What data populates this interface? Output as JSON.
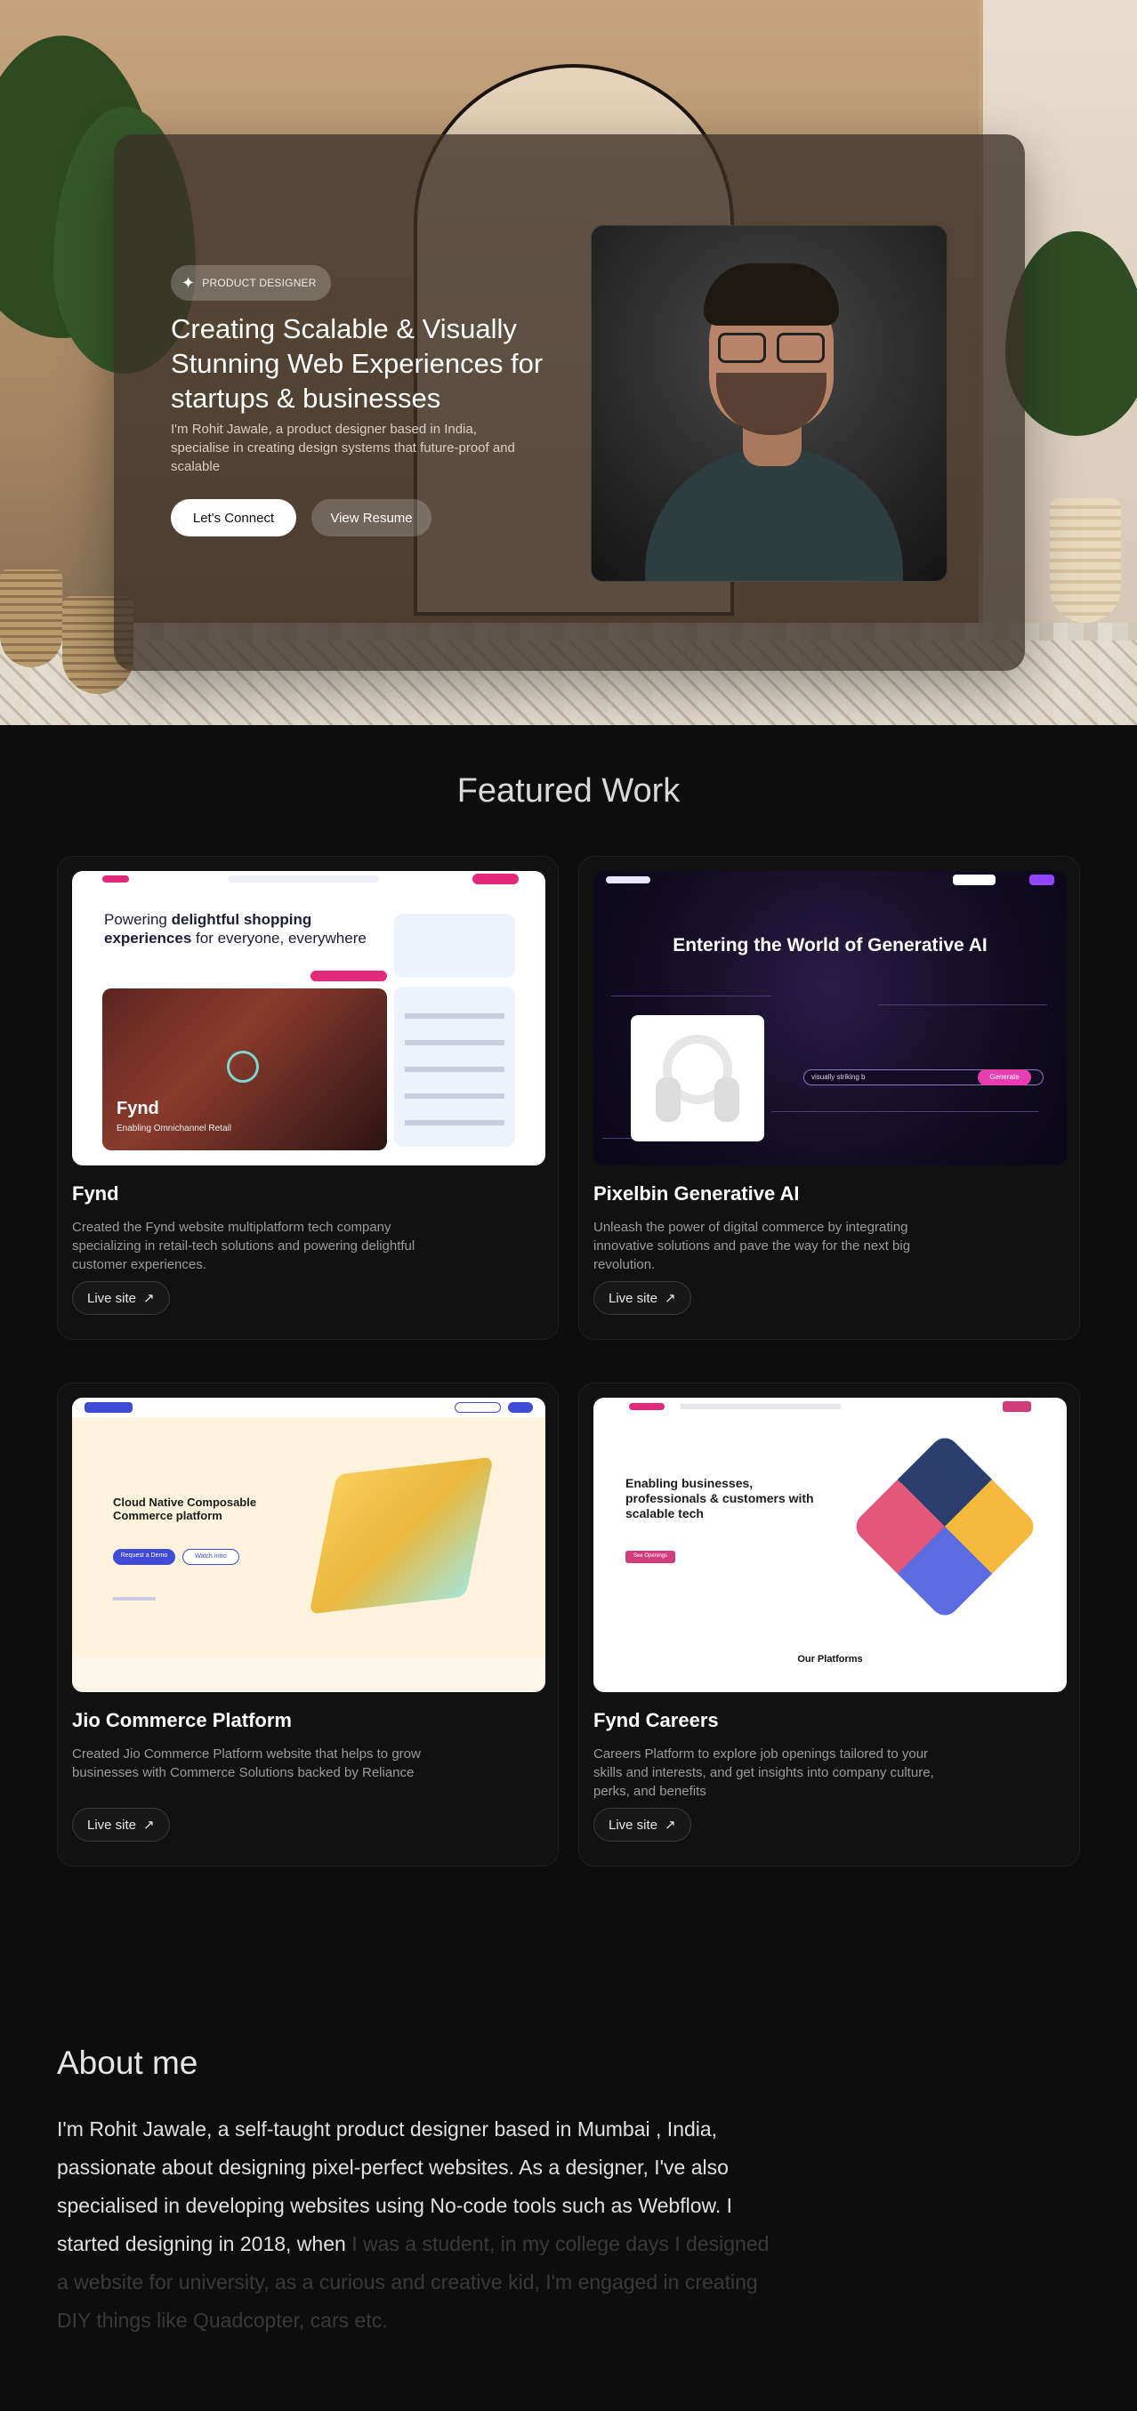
{
  "hero": {
    "badge": "PRODUCT DESIGNER",
    "title": "Creating Scalable & Visually Stunning Web Experiences for startups & businesses",
    "subtitle": "I'm Rohit Jawale, a product designer based in India, specialise in creating design systems that future-proof and scalable",
    "primary_button": "Let's Connect",
    "secondary_button": "View Resume"
  },
  "featured": {
    "title": "Featured Work",
    "live_label": "Live site",
    "projects": [
      {
        "title": "Fynd",
        "description": "Created the Fynd website multiplatform tech company specializing in retail-tech solutions and powering delightful customer experiences.",
        "preview": {
          "headline_a": "Powering ",
          "headline_b": "delightful shopping experiences",
          "headline_c": " for everyone, everywhere",
          "logo": "Fynd",
          "caption": "Enabling Omnichannel Retail"
        }
      },
      {
        "title": "Pixelbin Generative AI",
        "description": "Unleash the power of digital commerce by integrating innovative solutions and pave the way for the next big revolution.",
        "preview": {
          "headline": "Entering the World of Generative AI",
          "prompt": "visually striking b",
          "button": "Generate"
        }
      },
      {
        "title": "Jio Commerce Platform",
        "description": "Created Jio Commerce Platform website that helps to grow businesses with Commerce Solutions backed by Reliance",
        "preview": {
          "headline": "Cloud Native Composable Commerce platform",
          "button_a": "Request a Demo",
          "button_b": "Watch Intro"
        }
      },
      {
        "title": "Fynd Careers",
        "description": "Careers Platform to explore job openings tailored to your skills and interests, and get insights into company culture, perks, and benefits",
        "preview": {
          "headline": "Enabling businesses, professionals & customers with scalable tech",
          "button": "See Openings",
          "section": "Our Platforms"
        }
      }
    ]
  },
  "about": {
    "title": "About me",
    "text_visible": "I'm Rohit Jawale, a self-taught product designer based in Mumbai , India, passionate about designing pixel-perfect websites. As a designer, I've also specialised in developing websites using No-code tools such as Webflow. I started designing in 2018, when ",
    "text_faded": "I was a student, in my college days I designed a website for university, as a curious and creative kid, I'm engaged in creating DIY things like Quadcopter, cars etc."
  },
  "icons": {
    "badge": "sparkle-icon",
    "live_site": "arrow-up-right-icon"
  },
  "colors": {
    "background": "#0d0d0d",
    "card": "#111111",
    "muted_text": "#9b9b9b"
  }
}
